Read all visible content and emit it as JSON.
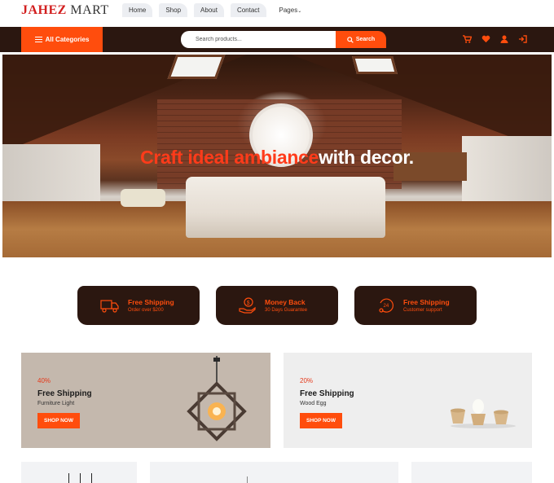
{
  "header": {
    "logo_part1": "JAHEZ",
    "logo_part2": "MART",
    "nav": [
      {
        "label": "Home"
      },
      {
        "label": "Shop"
      },
      {
        "label": "About"
      },
      {
        "label": "Contact"
      },
      {
        "label": "Pages"
      }
    ]
  },
  "bar": {
    "all_categories": "All Categories",
    "search_placeholder": "Search products...",
    "search_button": "Search",
    "icons": [
      "cart-icon",
      "heart-icon",
      "user-icon",
      "login-icon"
    ]
  },
  "hero": {
    "title_part1": "Craft ideal ambiance",
    "title_part2": "with decor."
  },
  "features": [
    {
      "title": "Free Shipping",
      "subtitle": "Order over $200",
      "icon": "truck-icon"
    },
    {
      "title": "Money Back",
      "subtitle": "30 Days Guarantee",
      "icon": "money-hand-icon"
    },
    {
      "title": "Free Shipping",
      "subtitle": "Customer support",
      "icon": "support-24-icon"
    }
  ],
  "promos": [
    {
      "discount": "40%",
      "title": "Free Shipping",
      "subtitle": "Furniture Light",
      "button": "SHOP NOW"
    },
    {
      "discount": "20%",
      "title": "Free Shipping",
      "subtitle": "Wood Egg",
      "button": "SHOP NOW"
    }
  ],
  "colors": {
    "accent": "#ff4d0d",
    "dark": "#2b1710",
    "logo_red": "#d21f1f"
  }
}
